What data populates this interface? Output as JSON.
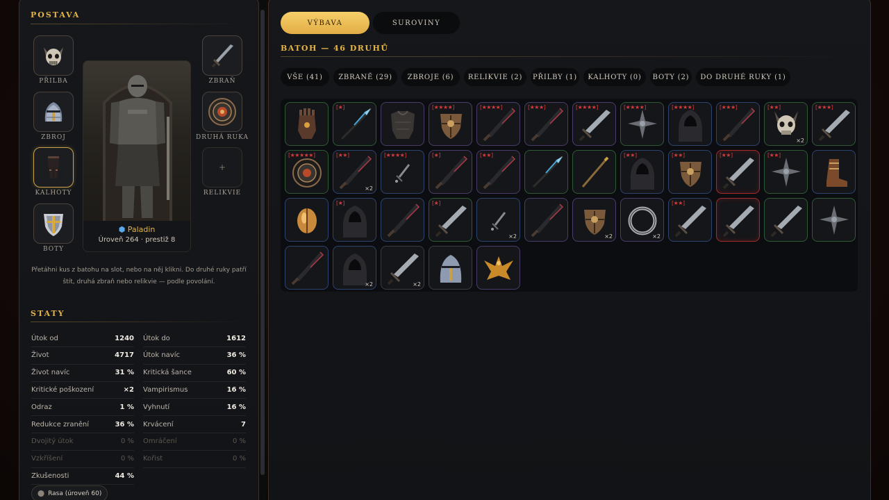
{
  "character": {
    "title": "POSTAVA",
    "slots": {
      "helmet": "PŘILBA",
      "weapon": "ZBRAŇ",
      "armor": "ZBROJ",
      "offhand": "DRUHÁ RUKA",
      "pants": "KALHOTY",
      "relic": "RELIKVIE",
      "boots": "BOTY"
    },
    "class_name": "Paladin",
    "level_text": "Úroveň 264 · prestiž 8",
    "hint": "Přetáhni kus z batohu na slot, nebo na něj klikni. Do druhé ruky patří štít, druhá zbraň nebo relikvie — podle povolání."
  },
  "stats": {
    "title": "STATY",
    "left": [
      {
        "label": "Útok od",
        "value": "1240"
      },
      {
        "label": "Život",
        "value": "4717"
      },
      {
        "label": "Život navíc",
        "value": "31 %"
      },
      {
        "label": "Kritické poškození",
        "value": "×2"
      },
      {
        "label": "Odraz",
        "value": "1 %"
      },
      {
        "label": "Redukce zranění",
        "value": "36 %"
      },
      {
        "label": "Dvojitý útok",
        "value": "0 %"
      },
      {
        "label": "Vzkříšení",
        "value": "0 %"
      },
      {
        "label": "Zkušenosti",
        "value": "44 %"
      }
    ],
    "right": [
      {
        "label": "Útok do",
        "value": "1612"
      },
      {
        "label": "Útok navíc",
        "value": "36 %"
      },
      {
        "label": "Kritická šance",
        "value": "60 %"
      },
      {
        "label": "Vampirismus",
        "value": "16 %"
      },
      {
        "label": "Vyhnutí",
        "value": "16 %"
      },
      {
        "label": "Krvácení",
        "value": "7"
      },
      {
        "label": "Omráčení",
        "value": "0 %"
      },
      {
        "label": "Kořist",
        "value": "0 %"
      }
    ],
    "chip": "Rasa (úroveň 60)"
  },
  "tabs": {
    "equipment": "VÝBAVA",
    "materials": "SUROVINY"
  },
  "inventory": {
    "title": "BATOH — 46 DRUHŮ",
    "filters": [
      "VŠE (41)",
      "ZBRANĚ (29)",
      "ZBROJE (6)",
      "RELIKVIE (2)",
      "PŘILBY (1)",
      "KALHOTY (0)",
      "BOTY (2)",
      "DO DRUHÉ RUKY (1)"
    ],
    "items": [
      {
        "icon": "gauntlet-icon",
        "stars": "",
        "qty": "",
        "rarity": "green"
      },
      {
        "icon": "spear-icon",
        "stars": "[★]",
        "qty": "",
        "rarity": "green"
      },
      {
        "icon": "chest-armor-icon",
        "stars": "",
        "qty": "",
        "rarity": "purple"
      },
      {
        "icon": "shield-icon",
        "stars": "[★★★★]",
        "qty": "",
        "rarity": "purple"
      },
      {
        "icon": "blade-icon",
        "stars": "[★★★★]",
        "qty": "",
        "rarity": "purple"
      },
      {
        "icon": "blade-icon",
        "stars": "[★★★]",
        "qty": "",
        "rarity": "purple"
      },
      {
        "icon": "sword-icon",
        "stars": "[★★★★]",
        "qty": "",
        "rarity": "purple"
      },
      {
        "icon": "star-relic-icon",
        "stars": "[★★★★]",
        "qty": "",
        "rarity": "green"
      },
      {
        "icon": "hood-icon",
        "stars": "[★★★★]",
        "qty": "",
        "rarity": "blue"
      },
      {
        "icon": "blade-icon",
        "stars": "[★★★]",
        "qty": "",
        "rarity": "blue"
      },
      {
        "icon": "skull-helm-icon",
        "stars": "[★★]",
        "qty": "×2",
        "rarity": "green"
      },
      {
        "icon": "sword-icon",
        "stars": "[★★★]",
        "qty": "",
        "rarity": "green"
      },
      {
        "icon": "round-shield-icon",
        "stars": "[★★★★★]",
        "qty": "",
        "rarity": "green"
      },
      {
        "icon": "blade-icon",
        "stars": "[★★]",
        "qty": "×2",
        "rarity": "blue"
      },
      {
        "icon": "dagger-icon",
        "stars": "[★★★★]",
        "qty": "",
        "rarity": "blue"
      },
      {
        "icon": "blade-icon",
        "stars": "[★]",
        "qty": "",
        "rarity": "purple"
      },
      {
        "icon": "blade-icon",
        "stars": "[★★]",
        "qty": "",
        "rarity": "purple"
      },
      {
        "icon": "spear-icon",
        "stars": "",
        "qty": "",
        "rarity": "green"
      },
      {
        "icon": "staff-icon",
        "stars": "",
        "qty": "",
        "rarity": "green"
      },
      {
        "icon": "hood-icon",
        "stars": "[★★]",
        "qty": "",
        "rarity": "blue"
      },
      {
        "icon": "shield-icon",
        "stars": "[★★]",
        "qty": "",
        "rarity": "blue"
      },
      {
        "icon": "sword-icon",
        "stars": "[★★]",
        "qty": "",
        "rarity": "red"
      },
      {
        "icon": "star-relic-icon",
        "stars": "[★★]",
        "qty": "",
        "rarity": "green"
      },
      {
        "icon": "boot-icon",
        "stars": "",
        "qty": "",
        "rarity": "blue"
      },
      {
        "icon": "orb-icon",
        "stars": "",
        "qty": "",
        "rarity": "blue"
      },
      {
        "icon": "hood-icon",
        "stars": "[★]",
        "qty": "",
        "rarity": "blue"
      },
      {
        "icon": "blade-icon",
        "stars": "",
        "qty": "",
        "rarity": "blue"
      },
      {
        "icon": "sword-icon",
        "stars": "[★]",
        "qty": "",
        "rarity": "green"
      },
      {
        "icon": "dagger-icon",
        "stars": "",
        "qty": "×2",
        "rarity": "blue"
      },
      {
        "icon": "blade-icon",
        "stars": "",
        "qty": "",
        "rarity": "purple"
      },
      {
        "icon": "shield-icon",
        "stars": "",
        "qty": "×2",
        "rarity": "purple"
      },
      {
        "icon": "ring-icon",
        "stars": "",
        "qty": "×2",
        "rarity": "purple"
      },
      {
        "icon": "sword-icon",
        "stars": "[★★]",
        "qty": "",
        "rarity": "blue"
      },
      {
        "icon": "sword-icon",
        "stars": "",
        "qty": "",
        "rarity": "red"
      },
      {
        "icon": "sword-icon",
        "stars": "",
        "qty": "",
        "rarity": "green"
      },
      {
        "icon": "star-relic-icon",
        "stars": "",
        "qty": "",
        "rarity": "green"
      },
      {
        "icon": "blade-icon",
        "stars": "",
        "qty": "",
        "rarity": "blue"
      },
      {
        "icon": "hood-icon",
        "stars": "",
        "qty": "×2",
        "rarity": "blue"
      },
      {
        "icon": "sword-icon",
        "stars": "",
        "qty": "×2",
        "rarity": "gray"
      },
      {
        "icon": "knight-helm-icon",
        "stars": "",
        "qty": "",
        "rarity": "gray"
      },
      {
        "icon": "phoenix-icon",
        "stars": "",
        "qty": "",
        "rarity": "purple"
      }
    ]
  },
  "colors": {
    "accent": "#e4b445",
    "star_red": "#d63c3c",
    "tab_active": "#f0c45a"
  }
}
